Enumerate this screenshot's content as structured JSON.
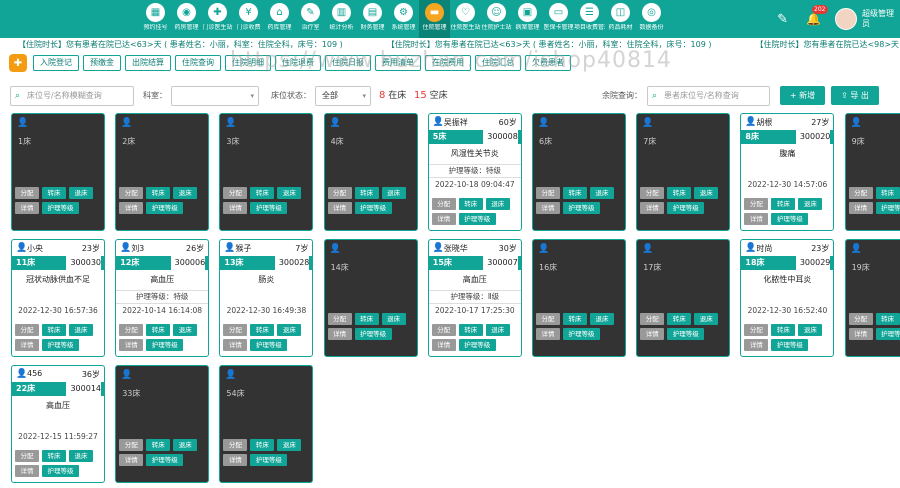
{
  "nav": [
    {
      "label": "预约挂号",
      "icon": "calendar-icon"
    },
    {
      "label": "药房管理",
      "icon": "pill-icon"
    },
    {
      "label": "门诊医生站",
      "icon": "doctor-icon"
    },
    {
      "label": "门诊收费",
      "icon": "cash-icon"
    },
    {
      "label": "药库管理",
      "icon": "warehouse-icon"
    },
    {
      "label": "治疗室",
      "icon": "syringe-icon"
    },
    {
      "label": "统计分析",
      "icon": "chart-icon"
    },
    {
      "label": "财务管理",
      "icon": "wallet-icon"
    },
    {
      "label": "系统管理",
      "icon": "gear-icon"
    },
    {
      "label": "住院管理",
      "icon": "bed-icon",
      "active": true
    },
    {
      "label": "住院医生站",
      "icon": "stethoscope-icon"
    },
    {
      "label": "住院护士站",
      "icon": "nurse-icon"
    },
    {
      "label": "病案管理",
      "icon": "folder-icon"
    },
    {
      "label": "医保卡管理",
      "icon": "card-icon"
    },
    {
      "label": "项目收费管理",
      "icon": "list-icon"
    },
    {
      "label": "药品耗材",
      "icon": "box-icon"
    },
    {
      "label": "数据备份",
      "icon": "database-icon"
    }
  ],
  "user": {
    "name": "超级管理员",
    "badge": "202"
  },
  "marquee": [
    "【住院时长】您有患者在院已达<63>天 ( 患者姓名：小丽，科室：住院全科，床号：109 )",
    "【住院时长】您有患者在院已达<63>天 ( 患者姓名：小丽，科室：住院全科，床号：109 )",
    "【住院时长】您有患者在院已达<98>天"
  ],
  "toolbar": [
    "入院登记",
    "预缴金",
    "出院结算",
    "住院查询",
    "住院明细",
    "住院退费",
    "住院日报",
    "费用清单",
    "在院费用",
    "住院汇总",
    "欠费患者"
  ],
  "watermark": "https://www.huzhan.com/ishop40814",
  "filters": {
    "search_placeholder": "床位号/名称模糊查询",
    "dept_label": "科室：",
    "dept_value": "",
    "status_label": "床位状态：",
    "status_value": "全部",
    "occupied_count": "8",
    "occupied_label": "在床",
    "vacant_count": "15",
    "vacant_label": "空床",
    "remain_label": "余院查询：",
    "remain_placeholder": "患者床位号/名称查询",
    "add_label": "+ 新增",
    "export_label": "导 出"
  },
  "action_labels": {
    "assign": "分配",
    "transfer": "转床",
    "return": "退床",
    "detail": "详情",
    "nursing": "护理等级"
  },
  "beds": [
    {
      "bed": "1床",
      "empty": true
    },
    {
      "bed": "2床",
      "empty": true
    },
    {
      "bed": "3床",
      "empty": true
    },
    {
      "bed": "4床",
      "empty": true
    },
    {
      "bed": "5床",
      "empty": false,
      "name": "吴振祥",
      "age": "60岁",
      "no": "300008",
      "diag": "风湿性关节炎",
      "level": "护理等级：特级",
      "date": "2022-10-18 09:04:47",
      "female": false
    },
    {
      "bed": "6床",
      "empty": true
    },
    {
      "bed": "7床",
      "empty": true
    },
    {
      "bed": "8床",
      "empty": false,
      "name": "胡根",
      "age": "27岁",
      "no": "300020",
      "diag": "腹痛",
      "level": "",
      "date": "2022-12-30 14:57:06",
      "female": false
    },
    {
      "bed": "9床",
      "empty": true
    },
    {
      "bed": "11床",
      "empty": false,
      "name": "小央",
      "age": "23岁",
      "no": "300030",
      "diag": "冠状动脉供血不足",
      "level": "",
      "date": "2022-12-30 16:57:36",
      "female": false
    },
    {
      "bed": "12床",
      "empty": false,
      "name": "刘3",
      "age": "26岁",
      "no": "300006",
      "diag": "高血压",
      "level": "护理等级：特级",
      "date": "2022-10-14 16:14:08",
      "female": false
    },
    {
      "bed": "13床",
      "empty": false,
      "name": "猴子",
      "age": "7岁",
      "no": "300028",
      "diag": "肠炎",
      "level": "",
      "date": "2022-12-30 16:49:38",
      "female": true
    },
    {
      "bed": "14床",
      "empty": true
    },
    {
      "bed": "15床",
      "empty": false,
      "name": "张晓华",
      "age": "30岁",
      "no": "300007",
      "diag": "高血压",
      "level": "护理等级：Ⅱ级",
      "date": "2022-10-17 17:25:30",
      "female": false
    },
    {
      "bed": "16床",
      "empty": true
    },
    {
      "bed": "17床",
      "empty": true
    },
    {
      "bed": "18床",
      "empty": false,
      "name": "时尚",
      "age": "23岁",
      "no": "300029",
      "diag": "化脓性中耳炎",
      "level": "",
      "date": "2022-12-30 16:52:40",
      "female": true
    },
    {
      "bed": "19床",
      "empty": true
    },
    {
      "bed": "22床",
      "empty": false,
      "name": "456",
      "age": "36岁",
      "no": "300014",
      "diag": "高血压",
      "level": "",
      "date": "2022-12-15 11:59:27",
      "female": false
    },
    {
      "bed": "33床",
      "empty": true
    },
    {
      "bed": "54床",
      "empty": true
    }
  ]
}
